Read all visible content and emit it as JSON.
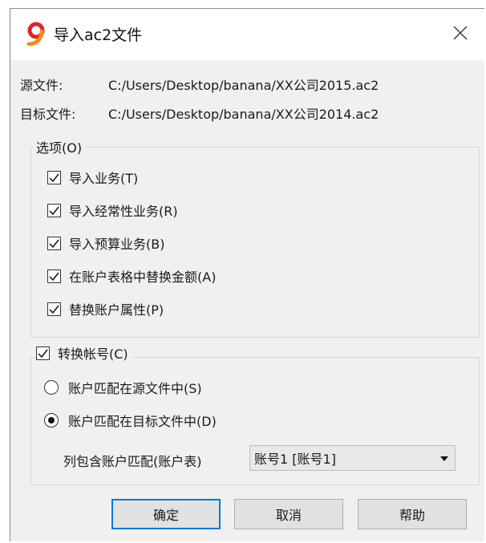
{
  "window": {
    "title": "导入ac2文件",
    "app_icon": "banana-app-icon",
    "close_icon": "close-icon"
  },
  "files": {
    "source_label": "源文件:",
    "source_path": "C:/Users/Desktop/banana/XX公司2015.ac2",
    "target_label": "目标文件:",
    "target_path": "C:/Users/Desktop/banana/XX公司2014.ac2"
  },
  "options": {
    "legend": "选项(O)",
    "items": [
      {
        "label": "导入业务(T)",
        "checked": true
      },
      {
        "label": "导入经常性业务(R)",
        "checked": true
      },
      {
        "label": "导入预算业务(B)",
        "checked": true
      },
      {
        "label": "在账户表格中替换金额(A)",
        "checked": true
      },
      {
        "label": "替换账户属性(P)",
        "checked": true
      }
    ]
  },
  "convert": {
    "label": "转换帐号(C)",
    "checked": true,
    "radios": [
      {
        "label": "账户匹配在源文件中(S)",
        "selected": false
      },
      {
        "label": "账户匹配在目标文件中(D)",
        "selected": true
      }
    ],
    "mapping_label": "列包含账户匹配(账户表)",
    "mapping_value": "账号1 [账号1]"
  },
  "buttons": {
    "ok": "确定",
    "cancel": "取消",
    "help": "帮助"
  },
  "colors": {
    "accent": "#0078d7",
    "dialog_bg": "#f0f0f0",
    "icon_orange": "#f28c1c",
    "icon_red": "#d9262c"
  }
}
